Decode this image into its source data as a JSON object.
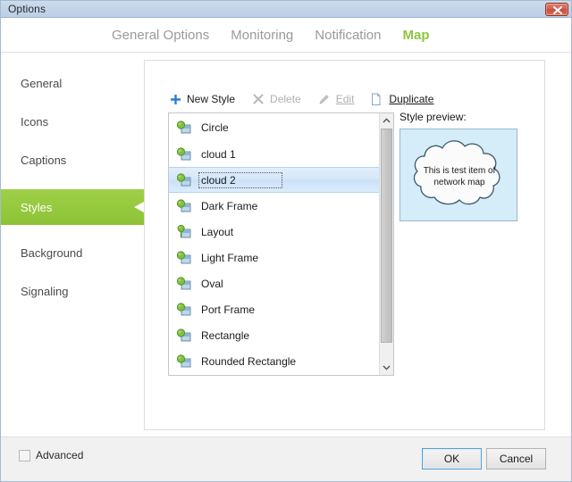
{
  "window": {
    "title": "Options",
    "close_icon": "close-icon"
  },
  "tabs": [
    {
      "label": "General Options",
      "active": false
    },
    {
      "label": "Monitoring",
      "active": false
    },
    {
      "label": "Notification",
      "active": false
    },
    {
      "label": "Map",
      "active": true
    }
  ],
  "sidebar": {
    "items": [
      {
        "label": "General",
        "active": false
      },
      {
        "label": "Icons",
        "active": false
      },
      {
        "label": "Captions",
        "active": false
      },
      {
        "label": "Styles",
        "active": true
      },
      {
        "label": "Background",
        "active": false
      },
      {
        "label": "Signaling",
        "active": false
      }
    ]
  },
  "toolbar": {
    "new_style_label": "New Style",
    "new_style_icon": "plus-icon",
    "delete_label": "Delete",
    "delete_icon": "cross-icon",
    "edit_label": "Edit",
    "edit_icon": "pencil-icon",
    "duplicate_label": "Duplicate",
    "duplicate_icon": "copy-page-icon"
  },
  "style_list": {
    "items": [
      {
        "label": "Circle",
        "icon": "style-shape-icon",
        "selected": false
      },
      {
        "label": "cloud 1",
        "icon": "style-shape-icon",
        "selected": false
      },
      {
        "label": "cloud 2",
        "icon": "style-shape-icon",
        "selected": true
      },
      {
        "label": "Dark Frame",
        "icon": "style-shape-icon",
        "selected": false
      },
      {
        "label": "Layout",
        "icon": "style-layout-icon",
        "selected": false
      },
      {
        "label": "Light Frame",
        "icon": "style-shape-icon",
        "selected": false
      },
      {
        "label": "Oval",
        "icon": "style-shape-icon",
        "selected": false
      },
      {
        "label": "Port Frame",
        "icon": "style-shape-icon",
        "selected": false
      },
      {
        "label": "Rectangle",
        "icon": "style-shape-icon",
        "selected": false
      },
      {
        "label": "Rounded Rectangle",
        "icon": "style-shape-icon",
        "selected": false
      }
    ],
    "scroll_up_icon": "chevron-up-icon",
    "scroll_down_icon": "chevron-down-icon"
  },
  "preview": {
    "label": "Style preview:",
    "shape": "cloud",
    "text": "This is test item of network map",
    "background_color": "#d5ecf9",
    "shape_fill": "#fbfbfb",
    "shape_stroke": "#3d5a6c"
  },
  "footer": {
    "advanced_label": "Advanced",
    "advanced_checked": false,
    "ok_label": "OK",
    "cancel_label": "Cancel"
  },
  "colors": {
    "accent_green": "#8cc63f",
    "titlebar": "#c3d4e8",
    "close_red": "#c94b38",
    "selection_blue": "#cbe1f8"
  }
}
